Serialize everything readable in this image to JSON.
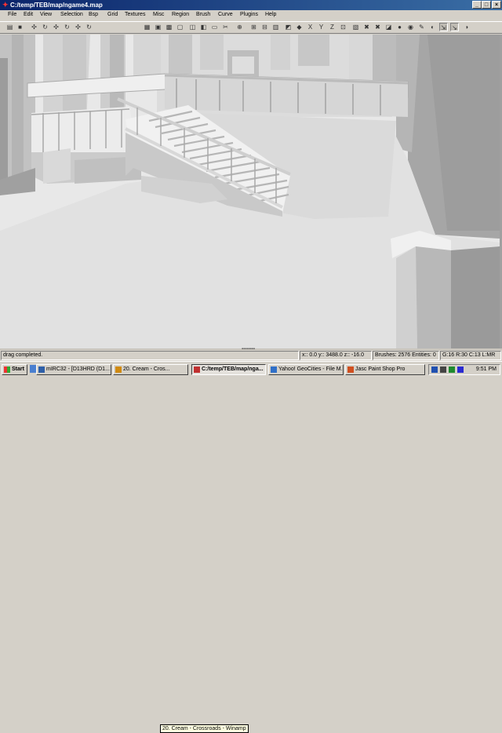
{
  "window": {
    "title": "C:/temp/TEB/map/ngame4.map",
    "controls": [
      "_",
      "□",
      "×"
    ]
  },
  "menu": [
    "File",
    "Edit",
    "View",
    "Selection",
    "Bsp",
    "Grid",
    "Textures",
    "Misc",
    "Region",
    "Brush",
    "Curve",
    "Plugins",
    "Help"
  ],
  "toolbar": {
    "buttons": [
      {
        "name": "open-icon",
        "glyph": "▤"
      },
      {
        "name": "save-icon",
        "glyph": "■"
      },
      {
        "name": "flip-x-icon",
        "glyph": "✣"
      },
      {
        "name": "rotate-x-icon",
        "glyph": "↻"
      },
      {
        "name": "flip-y-icon",
        "glyph": "✣"
      },
      {
        "name": "rotate-y-icon",
        "glyph": "↻"
      },
      {
        "name": "flip-z-icon",
        "glyph": "✣"
      },
      {
        "name": "rotate-z-icon",
        "glyph": "↻"
      },
      {
        "name": "select-complete-tall-icon",
        "glyph": "▦"
      },
      {
        "name": "select-touching-icon",
        "glyph": "▣"
      },
      {
        "name": "select-partial-tall-icon",
        "glyph": "▩"
      },
      {
        "name": "select-inside-icon",
        "glyph": "▢"
      },
      {
        "name": "csg-subtract-icon",
        "glyph": "◫"
      },
      {
        "name": "csg-merge-icon",
        "glyph": "◧"
      },
      {
        "name": "hollow-icon",
        "glyph": "▭"
      },
      {
        "name": "clipper-icon",
        "glyph": "✂"
      },
      {
        "name": "change-views-icon",
        "glyph": "⊕"
      },
      {
        "name": "view-xy-icon",
        "glyph": "⊞"
      },
      {
        "name": "view-z-icon",
        "glyph": "⊟"
      },
      {
        "name": "texture-view-icon",
        "glyph": "▥"
      },
      {
        "name": "cubic-clip-icon",
        "glyph": "◩"
      },
      {
        "name": "camera-move-icon",
        "glyph": "◆"
      },
      {
        "name": "x-view-icon",
        "glyph": "X"
      },
      {
        "name": "y-view-icon",
        "glyph": "Y"
      },
      {
        "name": "z-view-icon",
        "glyph": "Z"
      },
      {
        "name": "texture-lock-icon",
        "glyph": "⊡"
      },
      {
        "name": "filter-icon",
        "glyph": "▧"
      },
      {
        "name": "drag-edge-icon",
        "glyph": "✖"
      },
      {
        "name": "drag-vertex-icon",
        "glyph": "✖"
      },
      {
        "name": "scale-icon",
        "glyph": "◪"
      },
      {
        "name": "entity-icon",
        "glyph": "●"
      },
      {
        "name": "patch-icon",
        "glyph": "◉"
      },
      {
        "name": "light-icon",
        "glyph": "✎"
      },
      {
        "name": "select-patch-icon",
        "glyph": "◐"
      },
      {
        "name": "lock-grid-icon",
        "glyph": "⇲",
        "pressed": true
      },
      {
        "name": "show-size-icon",
        "glyph": "↘",
        "pressed": true
      },
      {
        "name": "plugin-icon",
        "glyph": "◗"
      }
    ]
  },
  "status": {
    "message": "drag completed.",
    "coords": "x:: 0.0  y:: 3488.0  z:: -16.0",
    "counts": "Brushes: 2576 Entities: 0",
    "grid": "G:16 R:30 C:13 L:MR"
  },
  "taskbar": {
    "start_label": "Start",
    "tasks": [
      {
        "label": "mIRC32 - [D13HRD (D1...",
        "color": "#2e5fa8"
      },
      {
        "label": "20. Cream - Cros...",
        "color": "#d08a10"
      },
      {
        "label": "C:/temp/TEB/map/nga...",
        "color": "#c03030",
        "active": true
      },
      {
        "label": "Yahoo! GeoCities - File M...",
        "color": "#3070c8"
      },
      {
        "label": "Jasc Paint Shop Pro",
        "color": "#d05020"
      }
    ],
    "tooltip": "20. Cream - Crossroads - Winamp",
    "clock": "9:51 PM"
  },
  "colors": {
    "title_start": "#0a246a",
    "title_end": "#3a6ea5",
    "chrome": "#d4d0c8",
    "viewport_bg": "#e6e6e6"
  }
}
